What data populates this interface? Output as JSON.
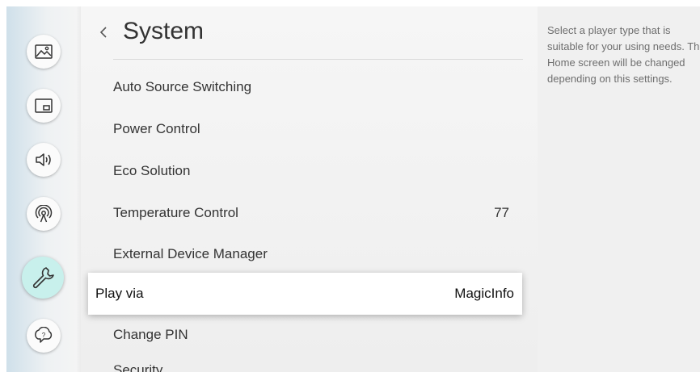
{
  "sidebar": {
    "items": [
      {
        "icon": "picture-icon",
        "active": false
      },
      {
        "icon": "pip-screen-icon",
        "active": false
      },
      {
        "icon": "sound-icon",
        "active": false
      },
      {
        "icon": "network-icon",
        "active": false
      },
      {
        "icon": "wrench-icon",
        "active": true
      },
      {
        "icon": "support-icon",
        "active": false
      }
    ]
  },
  "header": {
    "back_icon": "chevron-left-icon",
    "title": "System"
  },
  "menu": {
    "items": [
      {
        "label": "Auto Source Switching",
        "value": ""
      },
      {
        "label": "Power Control",
        "value": ""
      },
      {
        "label": "Eco Solution",
        "value": ""
      },
      {
        "label": "Temperature Control",
        "value": "77"
      },
      {
        "label": "External Device Manager",
        "value": ""
      },
      {
        "label": "Play via",
        "value": "MagicInfo",
        "selected": true
      },
      {
        "label": "Change PIN",
        "value": ""
      },
      {
        "label": "Security",
        "value": ""
      }
    ]
  },
  "help": {
    "text": "Select a player type that is suitable for your using needs. The Home screen will be changed depending on this settings."
  },
  "colors": {
    "accent_active": "#c8f0ec",
    "text": "#333333",
    "help_text": "#6e6e6e"
  }
}
